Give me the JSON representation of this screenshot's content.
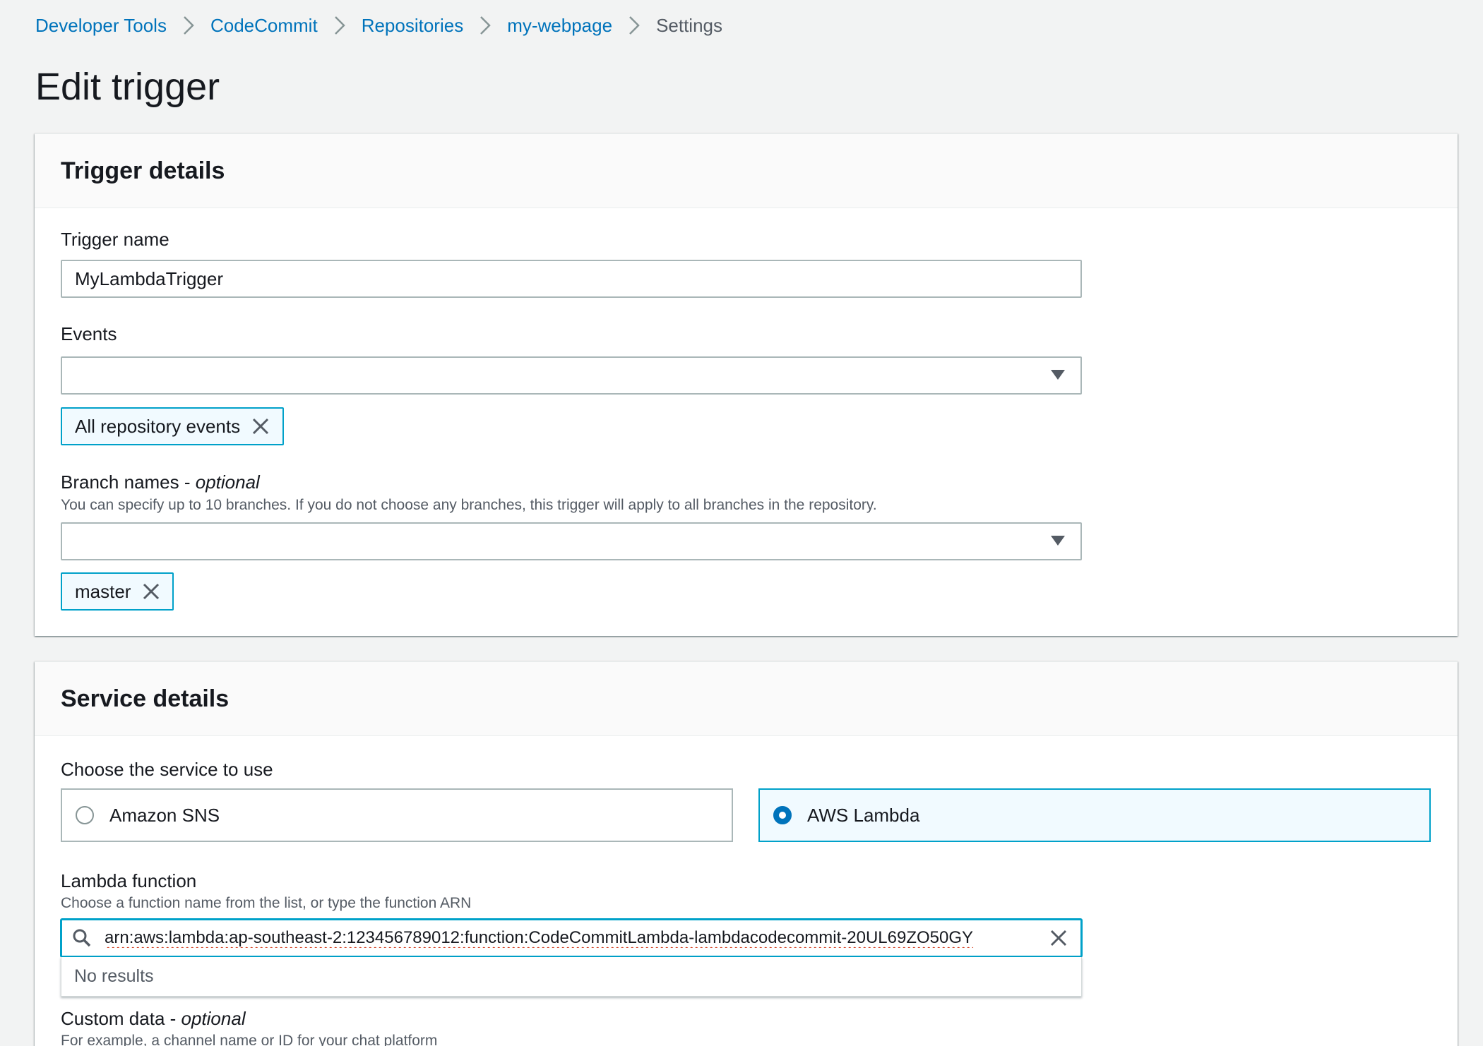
{
  "breadcrumbs": [
    {
      "label": "Developer Tools"
    },
    {
      "label": "CodeCommit"
    },
    {
      "label": "Repositories"
    },
    {
      "label": "my-webpage"
    },
    {
      "label": "Settings"
    }
  ],
  "page_title": "Edit trigger",
  "trigger_details": {
    "heading": "Trigger details",
    "trigger_name": {
      "label": "Trigger name",
      "value": "MyLambdaTrigger"
    },
    "events": {
      "label": "Events",
      "value": "",
      "tokens": [
        "All repository events"
      ]
    },
    "branch_names": {
      "label": "Branch names - ",
      "label_optional": "optional",
      "description": "You can specify up to 10 branches. If you do not choose any branches, this trigger will apply to all branches in the repository.",
      "value": "",
      "tokens": [
        "master"
      ]
    }
  },
  "service_details": {
    "heading": "Service details",
    "choose_label": "Choose the service to use",
    "options": [
      {
        "label": "Amazon SNS",
        "selected": false
      },
      {
        "label": "AWS Lambda",
        "selected": true
      }
    ],
    "lambda_function": {
      "label": "Lambda function",
      "description": "Choose a function name from the list, or type the function ARN",
      "value": "arn:aws:lambda:ap-southeast-2:123456789012:function:CodeCommitLambda-lambdacodecommit-20UL69ZO50GY",
      "no_results": "No results"
    },
    "custom_data": {
      "label": "Custom data - ",
      "label_optional": "optional",
      "description": "For example, a channel name or ID for your chat platform"
    }
  },
  "colors": {
    "link": "#0073bb",
    "accent": "#00a1c9",
    "background": "#f2f3f3"
  },
  "icons": {
    "breadcrumb_separator": "chevron-right-icon",
    "dropdown": "caret-down-icon",
    "token_remove": "close-icon",
    "search": "search-icon",
    "clear": "close-icon"
  }
}
